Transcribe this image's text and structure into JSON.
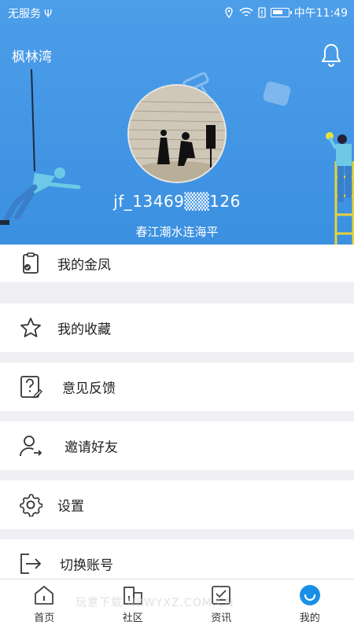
{
  "status_bar": {
    "carrier": "无服务",
    "usb_glyph": "Ψ",
    "time": "中午11:49"
  },
  "header": {
    "community": "枫林湾",
    "username": "jf_13469▒▒126",
    "signature": "春江潮水连海平",
    "background_color": "#4a9ce8"
  },
  "menu": {
    "items": [
      {
        "label": "我的金凤",
        "icon": "clipboard-check-icon"
      },
      {
        "label": "我的收藏",
        "icon": "star-icon"
      },
      {
        "label": "意见反馈",
        "icon": "question-edit-icon"
      },
      {
        "label": "邀请好友",
        "icon": "user-invite-icon"
      },
      {
        "label": "设置",
        "icon": "gear-icon"
      },
      {
        "label": "切换账号",
        "icon": "logout-icon"
      }
    ]
  },
  "bottom_nav": {
    "tabs": [
      {
        "label": "首页",
        "icon": "home-icon",
        "active": false
      },
      {
        "label": "社区",
        "icon": "community-icon",
        "active": false
      },
      {
        "label": "资讯",
        "icon": "news-icon",
        "active": false
      },
      {
        "label": "我的",
        "icon": "profile-smile-icon",
        "active": true
      }
    ],
    "active_color": "#1a8fe8"
  },
  "watermark": "玩意下载 NBWYXZ.COM.CN"
}
